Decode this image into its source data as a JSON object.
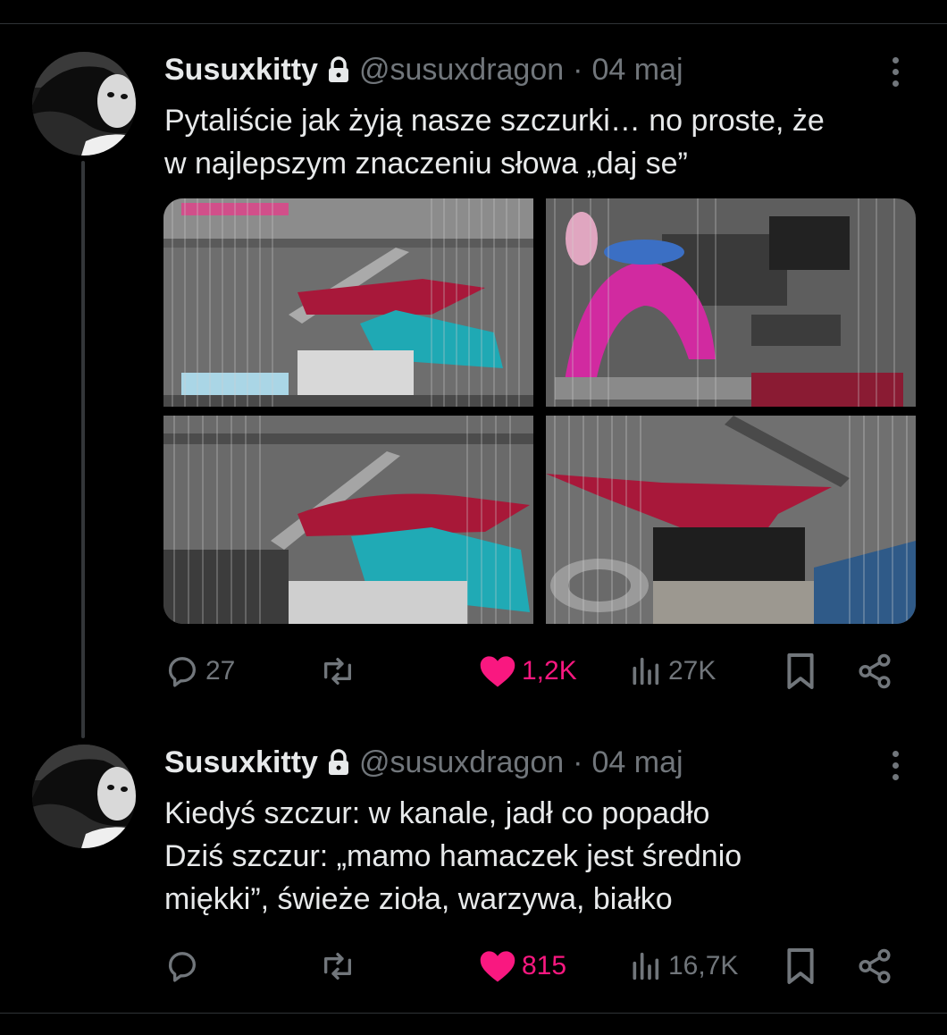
{
  "posts": [
    {
      "display_name": "Susuxkitty",
      "handle": "@susuxdragon",
      "separator": "·",
      "date": "04 maj",
      "text_lines": [
        "Pytaliście jak żyją nasze szczurki… no proste, że",
        "w najlepszym znaczeniu słowa „daj se”"
      ],
      "media_count": 4,
      "replies": "27",
      "reposts": "",
      "likes": "1,2K",
      "liked": true,
      "views": "27K"
    },
    {
      "display_name": "Susuxkitty",
      "handle": "@susuxdragon",
      "separator": "·",
      "date": "04 maj",
      "text_lines": [
        "Kiedyś szczur: w kanale, jadł co popadło",
        "Dziś szczur: „mamo hamaczek jest średnio",
        "miękki”, świeże zioła, warzywa, białko"
      ],
      "replies": "",
      "reposts": "",
      "likes": "815",
      "liked": true,
      "views": "16,7K"
    }
  ],
  "icons": {
    "lock": "lock-icon",
    "reply": "reply-icon",
    "repost": "repost-icon",
    "like": "heart-icon",
    "views": "views-icon",
    "bookmark": "bookmark-icon",
    "share": "share-icon",
    "more": "more-icon"
  },
  "colors": {
    "background": "#000000",
    "text": "#e7e9ea",
    "muted": "#71767b",
    "like": "#f91880",
    "divider": "#2f3336"
  }
}
